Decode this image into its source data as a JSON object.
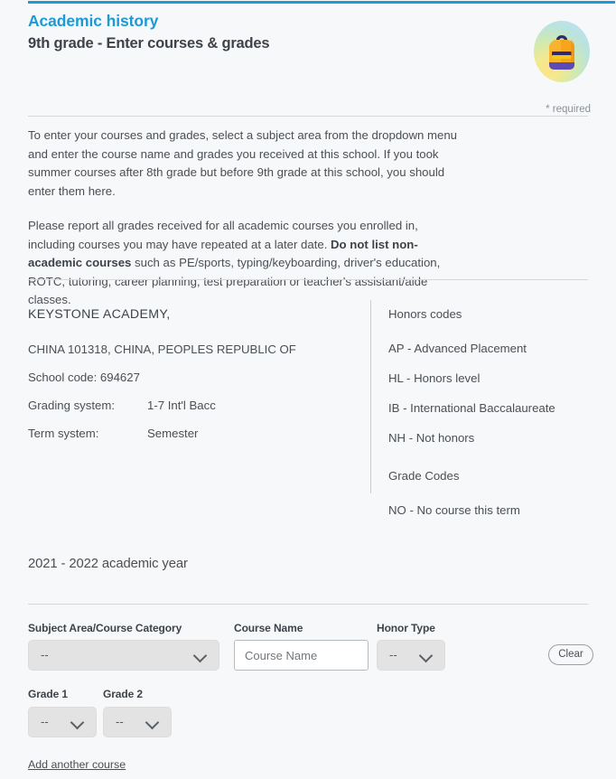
{
  "header": {
    "title": "Academic history",
    "subtitle": "9th grade - Enter courses & grades",
    "avatar_icon": "backpack-icon",
    "required_note": "* required",
    "accent_color": "#1b9ad6"
  },
  "instructions": {
    "paragraph1": "To enter your courses and grades, select a subject area from the dropdown menu and enter the course name and grades you received at this school. If you took summer courses after 8th grade but before 9th grade at this school, you should enter them here.",
    "paragraph2_part1": "Please report all grades received for all academic courses you enrolled in, including courses you may have repeated at a later date. ",
    "paragraph2_bold": "Do not list non-academic courses",
    "paragraph2_part2": " such as PE/sports, typing/keyboarding, driver's education, ROTC, tutoring, career planning, test preparation or teacher's assistant/aide classes."
  },
  "school": {
    "name": "KEYSTONE ACADEMY,",
    "location": "CHINA 101318, CHINA, PEOPLES REPUBLIC OF",
    "school_code_line": "School code: 694627",
    "grading_system_label": "Grading system:",
    "grading_system_value": "1-7 Int'l Bacc",
    "term_system_label": "Term system:",
    "term_system_value": "Semester"
  },
  "codes": {
    "honors_heading": "Honors codes",
    "honors_items": [
      "AP - Advanced Placement",
      "HL - Honors level",
      "IB - International Baccalaureate",
      "NH - Not honors"
    ],
    "grade_heading": "Grade Codes",
    "grade_items": [
      "NO - No course this term"
    ]
  },
  "academic_year": "2021 - 2022 academic year",
  "form": {
    "subject_label": "Subject Area/Course Category",
    "subject_value": "--",
    "course_name_label": "Course Name",
    "course_name_value": "",
    "course_name_placeholder": "Course Name",
    "honor_type_label": "Honor Type",
    "honor_type_value": "--",
    "grade1_label": "Grade 1",
    "grade1_value": "--",
    "grade2_label": "Grade 2",
    "grade2_value": "--",
    "clear_label": "Clear",
    "add_another_label": "Add another course"
  }
}
